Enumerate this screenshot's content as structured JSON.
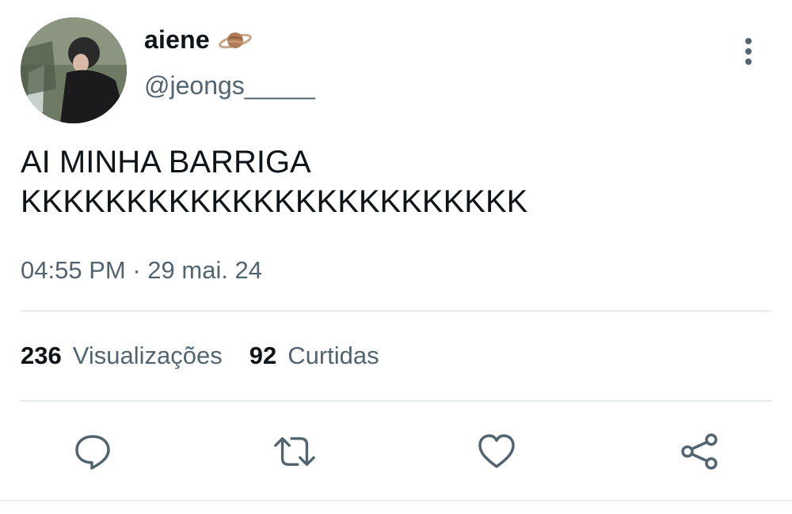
{
  "author": {
    "display_name": "aiene",
    "name_emoji": "planet-icon",
    "handle": "@jeongs_____"
  },
  "tweet": {
    "text": "AI MINHA BARRIGA\nKKKKKKKKKKKKKKKKKKKKKKKK",
    "time": "04:55 PM",
    "separator": "·",
    "date": "29 mai. 24"
  },
  "stats": {
    "views_count": "236",
    "views_label": "Visualizações",
    "likes_count": "92",
    "likes_label": "Curtidas"
  },
  "actions": [
    "reply-icon",
    "retweet-icon",
    "like-icon",
    "share-icon"
  ],
  "colors": {
    "text": "#0f1419",
    "secondary": "#536471",
    "divider": "#e6ecf0",
    "icon": "#536471"
  }
}
